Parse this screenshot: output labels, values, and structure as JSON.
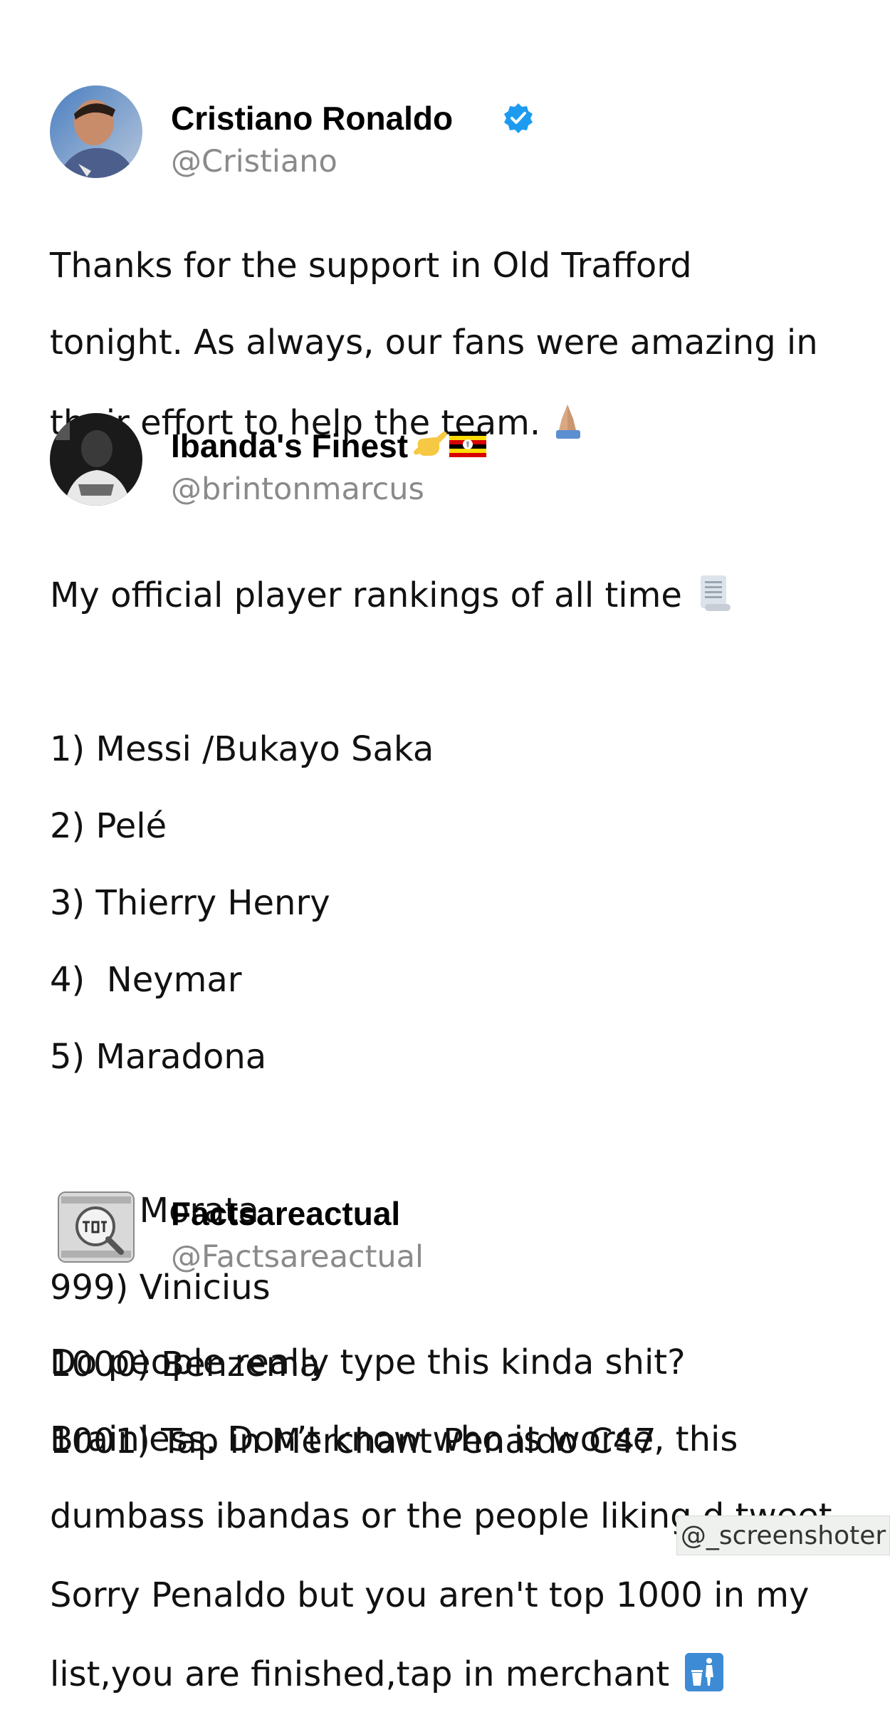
{
  "tweets": [
    {
      "display_name": "Cristiano Ronaldo",
      "handle": "@Cristiano",
      "verified": true,
      "name_icons": [
        "verified-badge-icon"
      ],
      "avatar_icon": "avatar-photo-cristiano",
      "lines": [
        "Thanks for the support in Old Trafford",
        "tonight. As always, our fans were amazing in",
        "their effort to help the team."
      ],
      "trailing_emoji": "folded-hands-icon"
    },
    {
      "display_name": "Ibanda's Finest",
      "handle": "@brintonmarcus",
      "verified": false,
      "name_icons": [
        "call-me-hand-icon",
        "uganda-flag-icon"
      ],
      "avatar_icon": "avatar-photo-brintonmarcus",
      "intro_line": "My official player rankings of all time",
      "intro_emoji": "scroll-icon",
      "rankings_top": [
        "1) Messi /Bukayo Saka",
        "2) Pelé",
        "3) Thierry Henry",
        "4)  Neymar",
        "5) Maradona"
      ],
      "rankings_bottom": [
        "998) Morata",
        "999) Vinicius",
        "1000) Benzema",
        "1001) Tap in Merchant Penaldo C47"
      ],
      "closing_lines": [
        "Sorry Penaldo but you aren't top 1000 in my",
        "list,you are finished,tap in merchant"
      ],
      "closing_emoji": "put-litter-in-bin-icon"
    },
    {
      "display_name": "Factsareactual",
      "handle": "@Factsareactual",
      "verified": false,
      "avatar_icon": "avatar-facts-logo",
      "lines": [
        "Do people really type this kinda shit?",
        "Brainless. Don’t know who is worse, this",
        "dumbass ibandas or the people liking d tweet"
      ]
    }
  ],
  "watermark": "@_screenshoter",
  "colors": {
    "name": "#000000",
    "handle": "#8a8a8a",
    "body": "#111111",
    "verified": "#1d9bf0",
    "watermark_bg": "#eef1ee"
  }
}
